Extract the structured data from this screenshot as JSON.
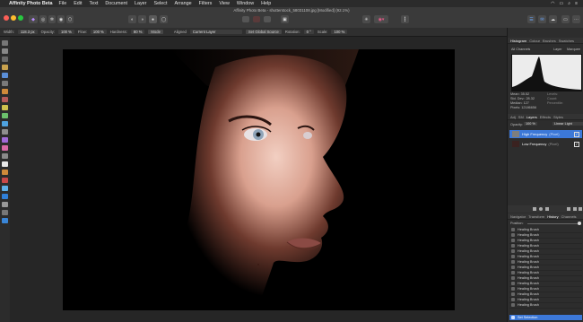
{
  "menubar": {
    "app": "Affinity Photo Beta",
    "items": [
      "File",
      "Edit",
      "Text",
      "Document",
      "Layer",
      "Select",
      "Arrange",
      "Filters",
      "View",
      "Window",
      "Help"
    ]
  },
  "window": {
    "title": "Affinity Photo Beta - shutterstock_58031108.jpg [Modified] (92.1%)"
  },
  "context": {
    "width_label": "Width:",
    "width_value": "118.3 px",
    "opacity_label": "Opacity:",
    "opacity_value": "100 %",
    "flow_label": "Flow:",
    "flow_value": "100 %",
    "hardness_label": "Hardness:",
    "hardness_value": "80 %",
    "mode_label": "Mode",
    "aligned_label": "Aligned",
    "source_value": "Current Layer",
    "global_source": "Set Global Source",
    "rotation_label": "Rotation:",
    "rotation_value": "0 °",
    "scale_label": "Scale:",
    "scale_value": "100 %"
  },
  "panel": {
    "top_tabs": [
      "Histogram",
      "Colour",
      "Brushes",
      "Swatches"
    ],
    "channels": "All Channels",
    "layer_btn": "Layer",
    "marquee_btn": "Marquee",
    "stats": {
      "mean": "Mean: 35.52",
      "std": "Std. Dev.: 28.32",
      "median": "Median: 127",
      "pixels": "Pixels: 12186656",
      "levels": "Levels:",
      "count": "Count:",
      "percentile": "Percentile:"
    },
    "mid_tabs": [
      "Adj",
      "SM",
      "Layers",
      "Effects",
      "Styles"
    ],
    "opacity_label": "Opacity:",
    "opacity_value": "100 %",
    "blend_mode": "Linear Light",
    "layers": [
      {
        "name": "High Frequency",
        "kind": "(Pixel)",
        "selected": true
      },
      {
        "name": "Low Frequency",
        "kind": "(Pixel)",
        "selected": false
      }
    ],
    "bottom_tabs": [
      "Navigator",
      "Transform",
      "History",
      "Channels"
    ],
    "position_label": "Position:",
    "history": [
      "Healing Brush",
      "Healing Brush",
      "Healing Brush",
      "Healing Brush",
      "Healing Brush",
      "Healing Brush",
      "Healing Brush",
      "Healing Brush",
      "Healing Brush",
      "Healing Brush",
      "Healing Brush",
      "Healing Brush",
      "Healing Brush",
      "Healing Brush",
      "Healing Brush",
      "Set Selection"
    ]
  }
}
